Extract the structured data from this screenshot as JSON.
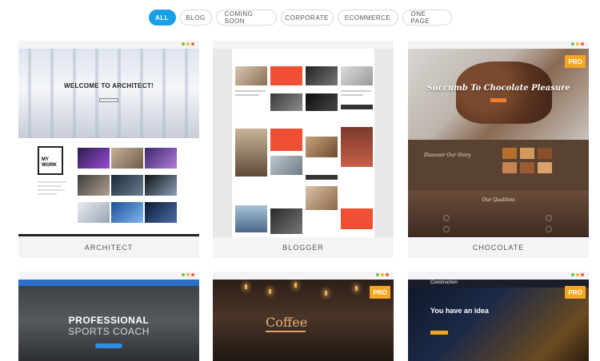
{
  "filters": {
    "all": "ALL",
    "blog": "BLOG",
    "coming_soon": "COMING SOON",
    "corporate": "CORPORATE",
    "ecommerce": "ECOMMERCE",
    "one_page": "ONE PAGE"
  },
  "cards": {
    "architect": {
      "label": "ARCHITECT",
      "hero_title": "WELCOME TO ARCHITECT!",
      "work_label": "MY WORK"
    },
    "blogger": {
      "label": "BLOGGER"
    },
    "chocolate": {
      "label": "CHOCOLATE",
      "badge": "PRO",
      "hero_title": "Succumb To Chocolate Pleasure",
      "story_title": "Discover Our Story",
      "qualities_title": "Our Qualities"
    },
    "sports": {
      "title_line1": "PROFESSIONAL",
      "title_line2": "SPORTS COACH"
    },
    "coffee": {
      "badge": "PRO",
      "title": "Coffee"
    },
    "construction": {
      "badge": "PRO",
      "logo": "Construction",
      "title": "You have an idea"
    }
  },
  "colors": {
    "accent": "#1aa0e6",
    "pro_badge": "#f5a623",
    "blog_red": "#ef4f32"
  }
}
